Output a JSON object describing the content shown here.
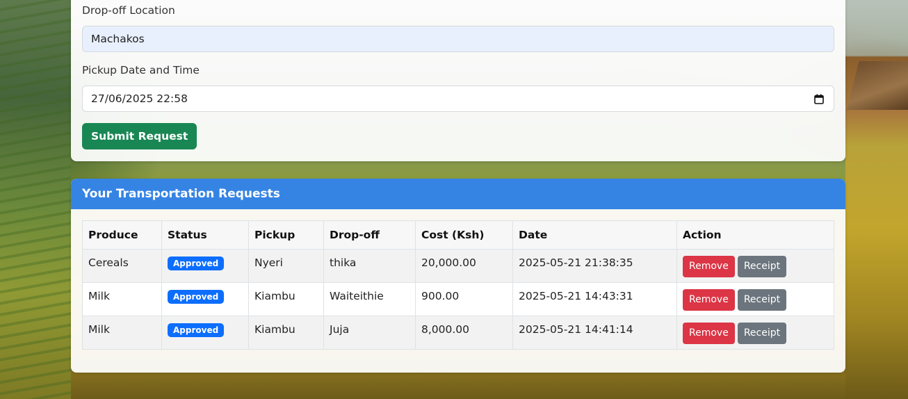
{
  "form": {
    "dropoff_label": "Drop-off Location",
    "dropoff_value": "Machakos",
    "pickup_label": "Pickup Date and Time",
    "pickup_value": "27/06/2025 22:58",
    "submit_label": "Submit Request"
  },
  "requests": {
    "title": "Your Transportation Requests",
    "columns": [
      "Produce",
      "Status",
      "Pickup",
      "Drop-off",
      "Cost (Ksh)",
      "Date",
      "Action"
    ],
    "rows": [
      {
        "produce": "Cereals",
        "status": "Approved",
        "pickup": "Nyeri",
        "dropoff": "thika",
        "cost": "20,000.00",
        "date": "2025-05-21 21:38:35"
      },
      {
        "produce": "Milk",
        "status": "Approved",
        "pickup": "Kiambu",
        "dropoff": "Waiteithie",
        "cost": "900.00",
        "date": "2025-05-21 14:43:31"
      },
      {
        "produce": "Milk",
        "status": "Approved",
        "pickup": "Kiambu",
        "dropoff": "Juja",
        "cost": "8,000.00",
        "date": "2025-05-21 14:41:14"
      }
    ],
    "remove_label": "Remove",
    "receipt_label": "Receipt"
  },
  "colors": {
    "header_blue": "#3584e4",
    "submit_green": "#198754",
    "badge_blue": "#0d6efd",
    "remove_red": "#dc3545",
    "receipt_gray": "#6c757d"
  }
}
